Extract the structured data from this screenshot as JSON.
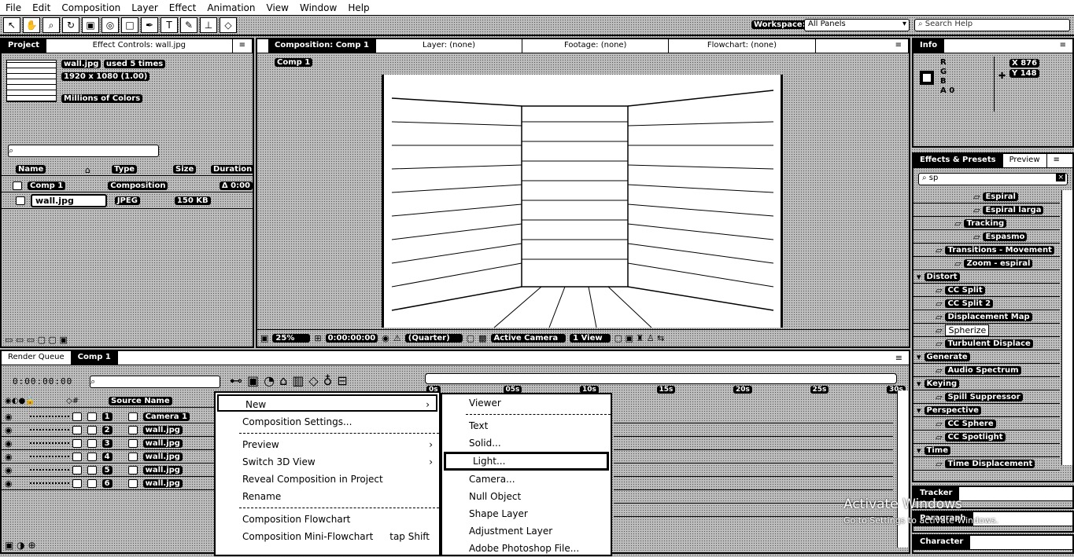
{
  "menu": [
    "File",
    "Edit",
    "Composition",
    "Layer",
    "Effect",
    "Animation",
    "View",
    "Window",
    "Help"
  ],
  "toolbar": {
    "workspace_label": "Workspace:",
    "workspace_value": "All Panels",
    "search_placeholder": "Search Help"
  },
  "project": {
    "tabs": [
      "Project",
      "Effect Controls: wall.jpg"
    ],
    "item_name": "wall.jpg",
    "item_used": "used 5 times",
    "item_dims": "1920 x 1080 (1.00)",
    "item_colors": "Millions of Colors",
    "columns": [
      "Name",
      "Type",
      "Size",
      "Duration"
    ],
    "rows": [
      {
        "name": "Comp 1",
        "type": "Composition",
        "size": "",
        "duration": "Δ 0:00"
      },
      {
        "name": "wall.jpg",
        "type": "JPEG",
        "size": "150 KB",
        "duration": ""
      }
    ]
  },
  "viewer": {
    "tabs": [
      "Composition: Comp 1",
      "Layer: (none)",
      "Footage: (none)",
      "Flowchart: (none)"
    ],
    "comp_chip": "Comp 1",
    "zoom": "25%",
    "timecode": "0:00:00:00",
    "resolution": "(Quarter)",
    "camera": "Active Camera",
    "view": "1 View"
  },
  "info": {
    "tab": "Info",
    "channels": [
      "R",
      "G",
      "B",
      "A"
    ],
    "a_value": "0",
    "x": "X 876",
    "y": "Y 148"
  },
  "effects": {
    "tabs": [
      "Effects & Presets",
      "Preview"
    ],
    "search": "sp",
    "items": [
      {
        "t": "Espiral",
        "l": 3
      },
      {
        "t": "Espiral larga",
        "l": 3
      },
      {
        "t": "Tracking",
        "l": 2
      },
      {
        "t": "Espasmo",
        "l": 3
      },
      {
        "t": "Transitions - Movement",
        "l": 1
      },
      {
        "t": "Zoom - espiral",
        "l": 2
      },
      {
        "t": "Distort",
        "l": 0
      },
      {
        "t": "CC Split",
        "l": 1
      },
      {
        "t": "CC Split 2",
        "l": 1
      },
      {
        "t": "Displacement Map",
        "l": 1
      },
      {
        "t": "Spherize",
        "l": 1
      },
      {
        "t": "Turbulent Displace",
        "l": 1
      },
      {
        "t": "Generate",
        "l": 0
      },
      {
        "t": "Audio Spectrum",
        "l": 1
      },
      {
        "t": "Keying",
        "l": 0
      },
      {
        "t": "Spill Suppressor",
        "l": 1
      },
      {
        "t": "Perspective",
        "l": 0
      },
      {
        "t": "CC Sphere",
        "l": 1
      },
      {
        "t": "CC Spotlight",
        "l": 1
      },
      {
        "t": "Time",
        "l": 0
      },
      {
        "t": "Time Displacement",
        "l": 1
      }
    ]
  },
  "lower_tabs": [
    "Tracker",
    "Paragraph",
    "Character"
  ],
  "timeline": {
    "tabs": [
      "Render Queue",
      "Comp 1"
    ],
    "timecode": "0:00:00:00",
    "source_header": "Source Name",
    "layers": [
      {
        "n": "1",
        "name": "Camera 1"
      },
      {
        "n": "2",
        "name": "wall.jpg"
      },
      {
        "n": "3",
        "name": "wall.jpg"
      },
      {
        "n": "4",
        "name": "wall.jpg"
      },
      {
        "n": "5",
        "name": "wall.jpg"
      },
      {
        "n": "6",
        "name": "wall.jpg"
      }
    ],
    "ticks": [
      "0s",
      "05s",
      "10s",
      "15s",
      "20s",
      "25s",
      "30s"
    ]
  },
  "context_menu": {
    "items": [
      "New",
      "Composition Settings...",
      "Preview",
      "Switch 3D View",
      "Reveal Composition in Project",
      "Rename",
      "Composition Flowchart",
      "Composition Mini-Flowchart"
    ],
    "shortcut": "tap Shift"
  },
  "submenu": {
    "items": [
      "Viewer",
      "Text",
      "Solid...",
      "Light...",
      "Camera...",
      "Null Object",
      "Shape Layer",
      "Adjustment Layer",
      "Adobe Photoshop File..."
    ]
  },
  "watermark": {
    "line1": "Activate Windows",
    "line2": "Go to Settings to activate Windows."
  }
}
